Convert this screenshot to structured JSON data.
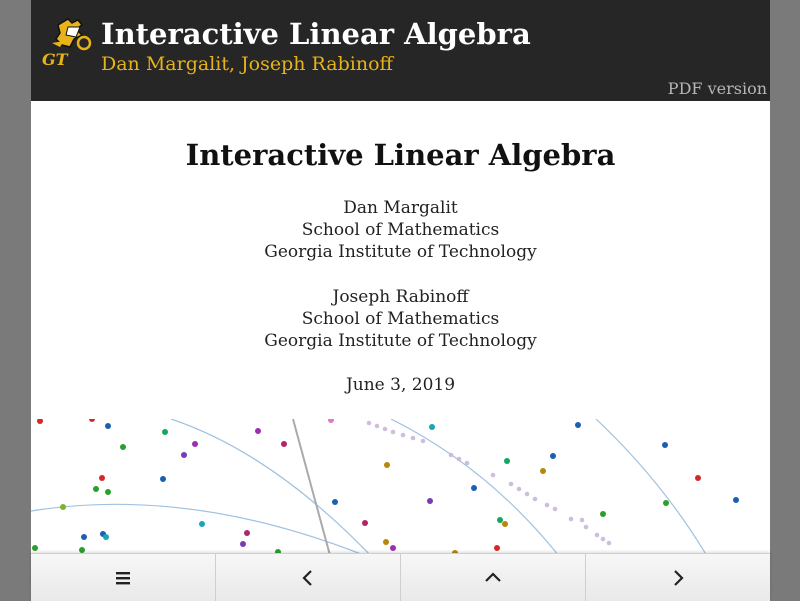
{
  "header": {
    "logo_text": "GT",
    "title": "Interactive Linear Algebra",
    "authors": "Dan Margalit, Joseph Rabinoff",
    "pdf_link": "PDF version"
  },
  "titlepage": {
    "title": "Interactive Linear Algebra",
    "authors": [
      {
        "name": "Dan Margalit",
        "department": "School of Mathematics",
        "institution": "Georgia Institute of Technology"
      },
      {
        "name": "Joseph Rabinoff",
        "department": "School of Mathematics",
        "institution": "Georgia Institute of Technology"
      }
    ],
    "date": "June 3, 2019"
  },
  "navbar": {
    "buttons": [
      {
        "icon": "menu-icon"
      },
      {
        "icon": "chevron-left-icon"
      },
      {
        "icon": "chevron-up-icon"
      },
      {
        "icon": "chevron-right-icon"
      }
    ]
  },
  "colors": {
    "header_bg": "#262626",
    "accent_gold": "#e8b318",
    "pdf_link": "#b6b6b6",
    "curve": "#9fc1e0",
    "dots": [
      "#1b5fb3",
      "#2aa02a",
      "#d62728",
      "#9b2fae",
      "#1aa6b7",
      "#b7860b",
      "#13a75f",
      "#e377c2"
    ]
  }
}
